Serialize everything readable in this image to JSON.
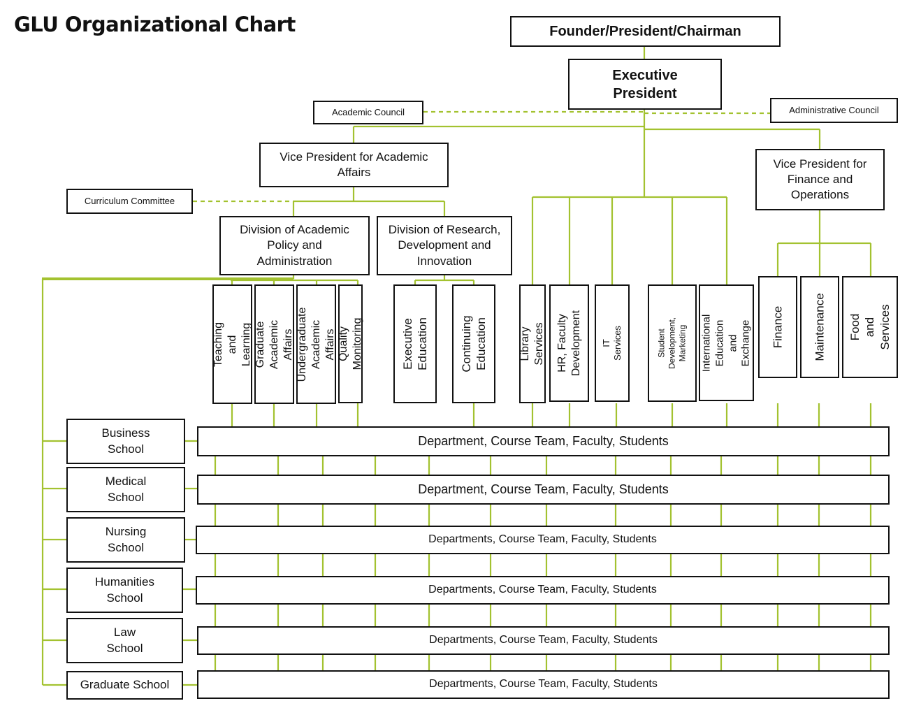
{
  "title": "GLU Organizational Chart",
  "accent_color": "#a3c230",
  "top": {
    "founder": "Founder/President/Chairman",
    "executive_president": "Executive President"
  },
  "councils": {
    "academic": "Academic Council",
    "administrative": "Administrative Council",
    "curriculum": "Curriculum Committee"
  },
  "vice_presidents": {
    "academic": "Vice President for Academic Affairs",
    "finance": "Vice President for Finance and Operations"
  },
  "divisions": {
    "academic_policy": "Division of Academic Policy and Administration",
    "research": "Division of Research, Development and Innovation"
  },
  "units": {
    "academic_policy": [
      "Teaching and\nLearning",
      "Graduate Academic\nAffairs",
      "Undergraduate\nAcademic Affairs",
      "Quality Monitoring"
    ],
    "research": [
      "Executive\nEducation",
      "Continuing\nEducation"
    ],
    "executive": [
      "Library Services",
      "HR, Faculty\nDevelopment",
      "IT Services",
      "Student Development,\nMarketing",
      "International\nEducation and\nExchange"
    ],
    "finance": [
      "Finance",
      "Maintenance",
      "Food and\nServices"
    ]
  },
  "schools": [
    {
      "name": "Business School",
      "departments": "Department, Course Team, Faculty, Students"
    },
    {
      "name": "Medical School",
      "departments": "Department, Course Team, Faculty, Students"
    },
    {
      "name": "Nursing School",
      "departments": "Departments, Course Team, Faculty, Students"
    },
    {
      "name": "Humanities School",
      "departments": "Departments, Course Team, Faculty, Students"
    },
    {
      "name": "Law School",
      "departments": "Departments, Course Team, Faculty, Students"
    },
    {
      "name": "Graduate School",
      "departments": "Departments, Course Team, Faculty, Students"
    }
  ]
}
